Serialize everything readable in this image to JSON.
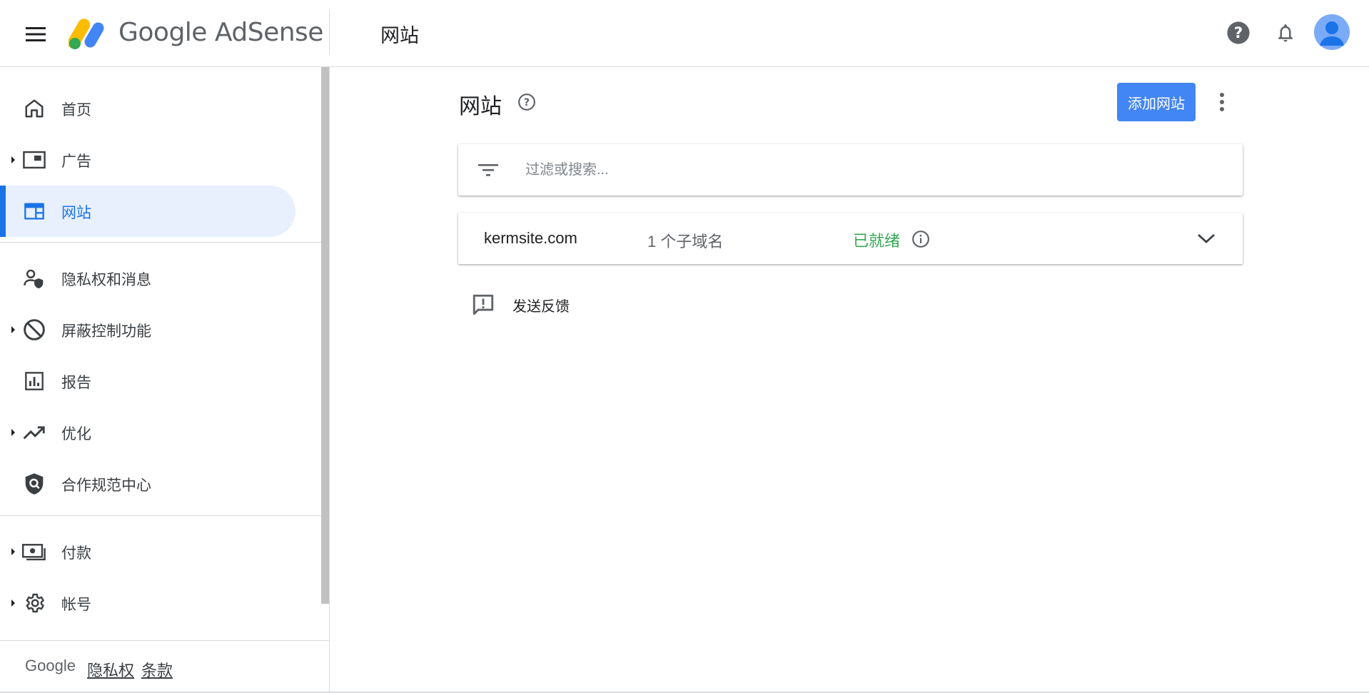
{
  "header": {
    "brand_text": "Google AdSense",
    "page_title": "网站",
    "icons": [
      "menu-icon",
      "help-icon",
      "bell-icon",
      "account-avatar"
    ]
  },
  "sidebar": {
    "items": [
      {
        "label": "首页",
        "icon": "home-icon",
        "expandable": false,
        "active": false
      },
      {
        "label": "广告",
        "icon": "ads-icon",
        "expandable": true,
        "active": false
      },
      {
        "label": "网站",
        "icon": "sites-icon",
        "expandable": false,
        "active": true
      },
      {
        "label": "隐私权和消息",
        "icon": "privacy-icon",
        "expandable": false,
        "active": false
      },
      {
        "label": "屏蔽控制功能",
        "icon": "block-icon",
        "expandable": true,
        "active": false
      },
      {
        "label": "报告",
        "icon": "reports-icon",
        "expandable": false,
        "active": false
      },
      {
        "label": "优化",
        "icon": "trending-icon",
        "expandable": true,
        "active": false
      },
      {
        "label": "合作规范中心",
        "icon": "policy-icon",
        "expandable": false,
        "active": false
      },
      {
        "label": "付款",
        "icon": "payments-icon",
        "expandable": true,
        "active": false
      },
      {
        "label": "帐号",
        "icon": "settings-icon",
        "expandable": true,
        "active": false
      }
    ],
    "footer": {
      "google": "Google",
      "privacy": "隐私权",
      "terms": "条款"
    }
  },
  "main": {
    "title": "网站",
    "add_site_label": "添加网站",
    "filter_placeholder": "过滤或搜索...",
    "sites": [
      {
        "domain": "kermsite.com",
        "subdomains": "1 个子域名",
        "status": "已就绪"
      }
    ],
    "feedback_label": "发送反馈"
  },
  "colors": {
    "accent": "#1a73e8",
    "button": "#4285f4",
    "active_bg": "#e8f0fe",
    "status_ready": "#34a853"
  }
}
